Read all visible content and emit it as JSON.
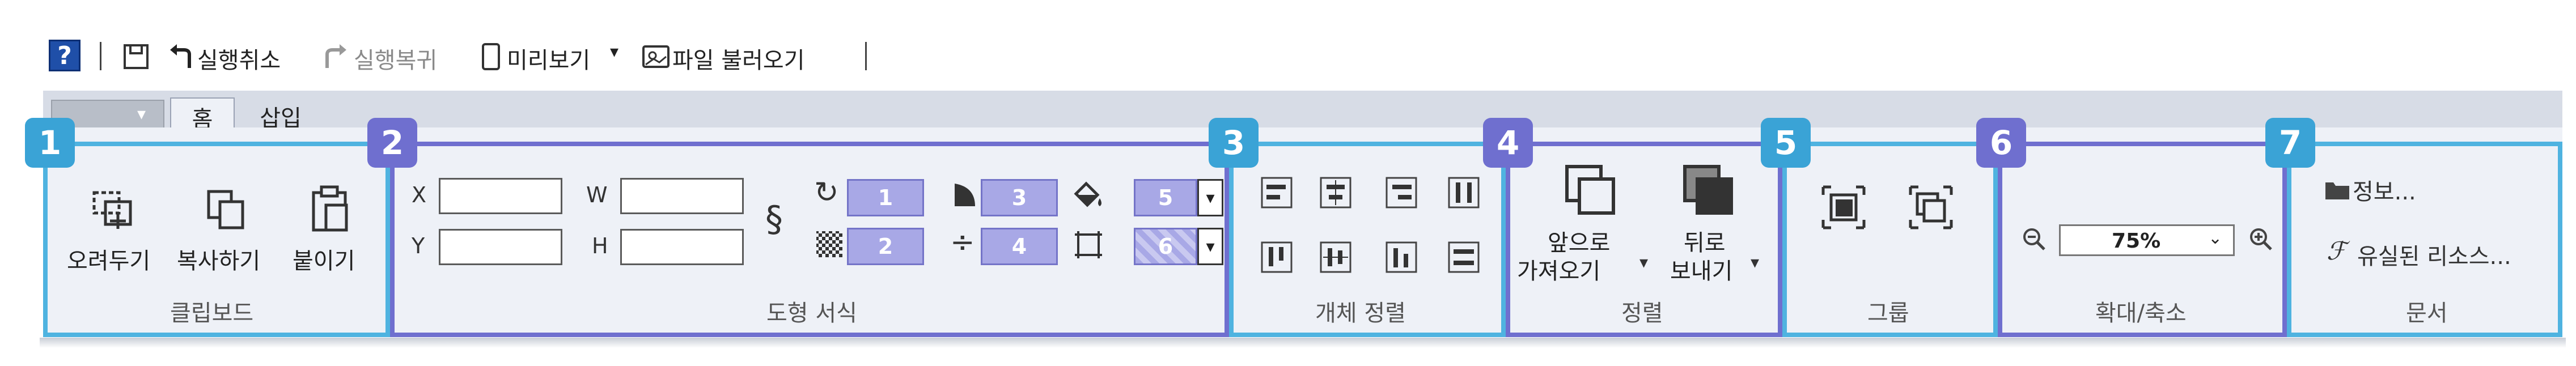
{
  "quick_access": {
    "save_icon": "save-icon",
    "undo_label": "실행취소",
    "redo_label": "실행복귀",
    "preview_label": "미리보기",
    "import_label": "파일 불러오기"
  },
  "tabs": [
    {
      "label": "홈",
      "active": true
    },
    {
      "label": "삽입",
      "active": false
    }
  ],
  "groups": {
    "clipboard": {
      "badge": "1",
      "label": "클립보드",
      "buttons": [
        "오려두기",
        "복사하기",
        "붙이기"
      ]
    },
    "shape_format": {
      "badge": "2",
      "label": "도형 서식",
      "x_label": "X",
      "y_label": "Y",
      "w_label": "W",
      "h_label": "H",
      "boxes": [
        "1",
        "2",
        "3",
        "4",
        "5",
        "6"
      ]
    },
    "object_align": {
      "badge": "3",
      "label": "개체 정렬"
    },
    "arrange": {
      "badge": "4",
      "label": "정렬",
      "front_line1": "앞으로",
      "front_line2": "가져오기",
      "back_line1": "뒤로",
      "back_line2": "보내기"
    },
    "group": {
      "badge": "5",
      "label": "그룹"
    },
    "zoom": {
      "badge": "6",
      "label": "확대/축소",
      "value": "75%"
    },
    "document": {
      "badge": "7",
      "label": "문서",
      "info": "정보...",
      "unused": "유실된 리소스..."
    }
  },
  "colors": {
    "blue_frame": "#4fb3e0",
    "purple_frame": "#6f6fcf",
    "box_fill": "#a8a8e6"
  }
}
